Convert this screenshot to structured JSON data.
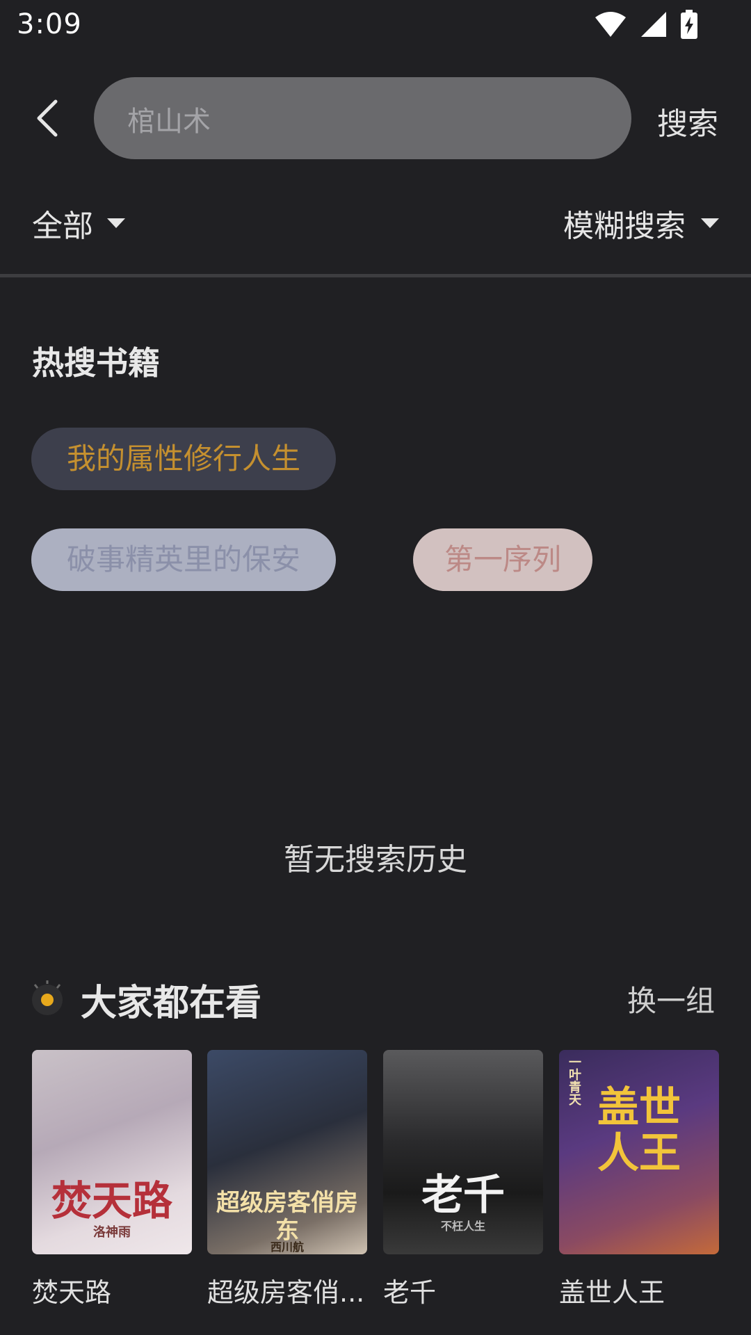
{
  "status_bar": {
    "time": "3:09"
  },
  "search": {
    "value": "棺山术",
    "submit_label": "搜索"
  },
  "filters": {
    "category": "全部",
    "mode": "模糊搜索"
  },
  "hot_search": {
    "title": "热搜书籍",
    "tags": [
      {
        "label": "我的属性修行人生"
      },
      {
        "label": "破事精英里的保安"
      },
      {
        "label": "第一序列"
      }
    ]
  },
  "history": {
    "empty_text": "暂无搜索历史"
  },
  "recommend": {
    "title": "大家都在看",
    "refresh_label": "换一组",
    "books": [
      {
        "title": "焚天路",
        "cover_text": "焚天路",
        "cover_author": "洛神雨"
      },
      {
        "title": "超级房客俏...",
        "cover_text": "超级房客俏房东",
        "cover_author": "西川航"
      },
      {
        "title": "老千",
        "cover_text": "老千",
        "cover_author": "不枉人生"
      },
      {
        "title": "盖世人王",
        "cover_text": "盖世人王",
        "cover_author": "一叶青天"
      }
    ]
  },
  "colors": {
    "background": "#202023",
    "accent_tag_text": "#c5902f",
    "eye_dot": "#e8a91c"
  }
}
